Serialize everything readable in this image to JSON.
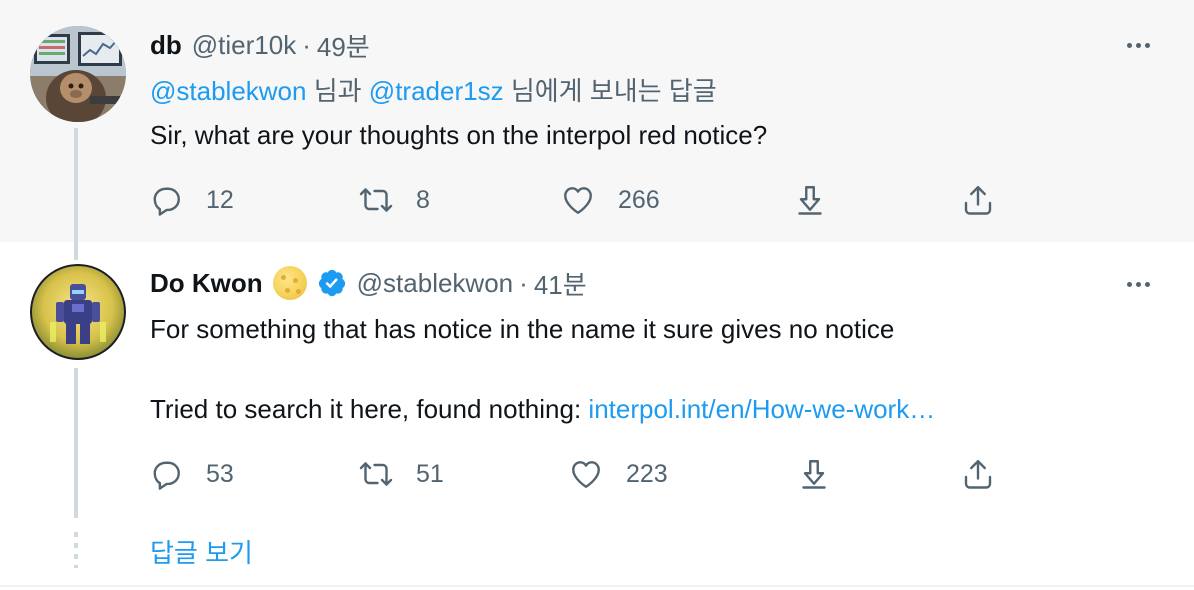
{
  "tweets": [
    {
      "name": "db",
      "handle": "@tier10k",
      "separator": "·",
      "time": "49분",
      "reply_to": {
        "user1": "@stablekwon",
        "connector": "님과",
        "user2": "@trader1sz",
        "suffix": "님에게 보내는 답글"
      },
      "text": "Sir, what are your thoughts on the interpol red notice?",
      "stats": {
        "replies": "12",
        "retweets": "8",
        "likes": "266"
      }
    },
    {
      "name": "Do Kwon",
      "name_emoji": "cookie-emoji",
      "verified": true,
      "handle": "@stablekwon",
      "separator": "·",
      "time": "41분",
      "line1": "For something that has notice in the name it sure gives no notice",
      "line2_text": "Tried to search it here, found nothing:",
      "line2_link": "interpol.int/en/How-we-work…",
      "stats": {
        "replies": "53",
        "retweets": "51",
        "likes": "223"
      }
    }
  ],
  "show_replies": "답글 보기",
  "colors": {
    "accent": "#1d9bf0",
    "muted": "#536471",
    "text": "#0f1419",
    "bg_focused": "#f7f7f7"
  },
  "icons": [
    "reply-icon",
    "retweet-icon",
    "like-icon",
    "download-icon",
    "share-icon",
    "more-icon",
    "verified-badge-icon"
  ]
}
